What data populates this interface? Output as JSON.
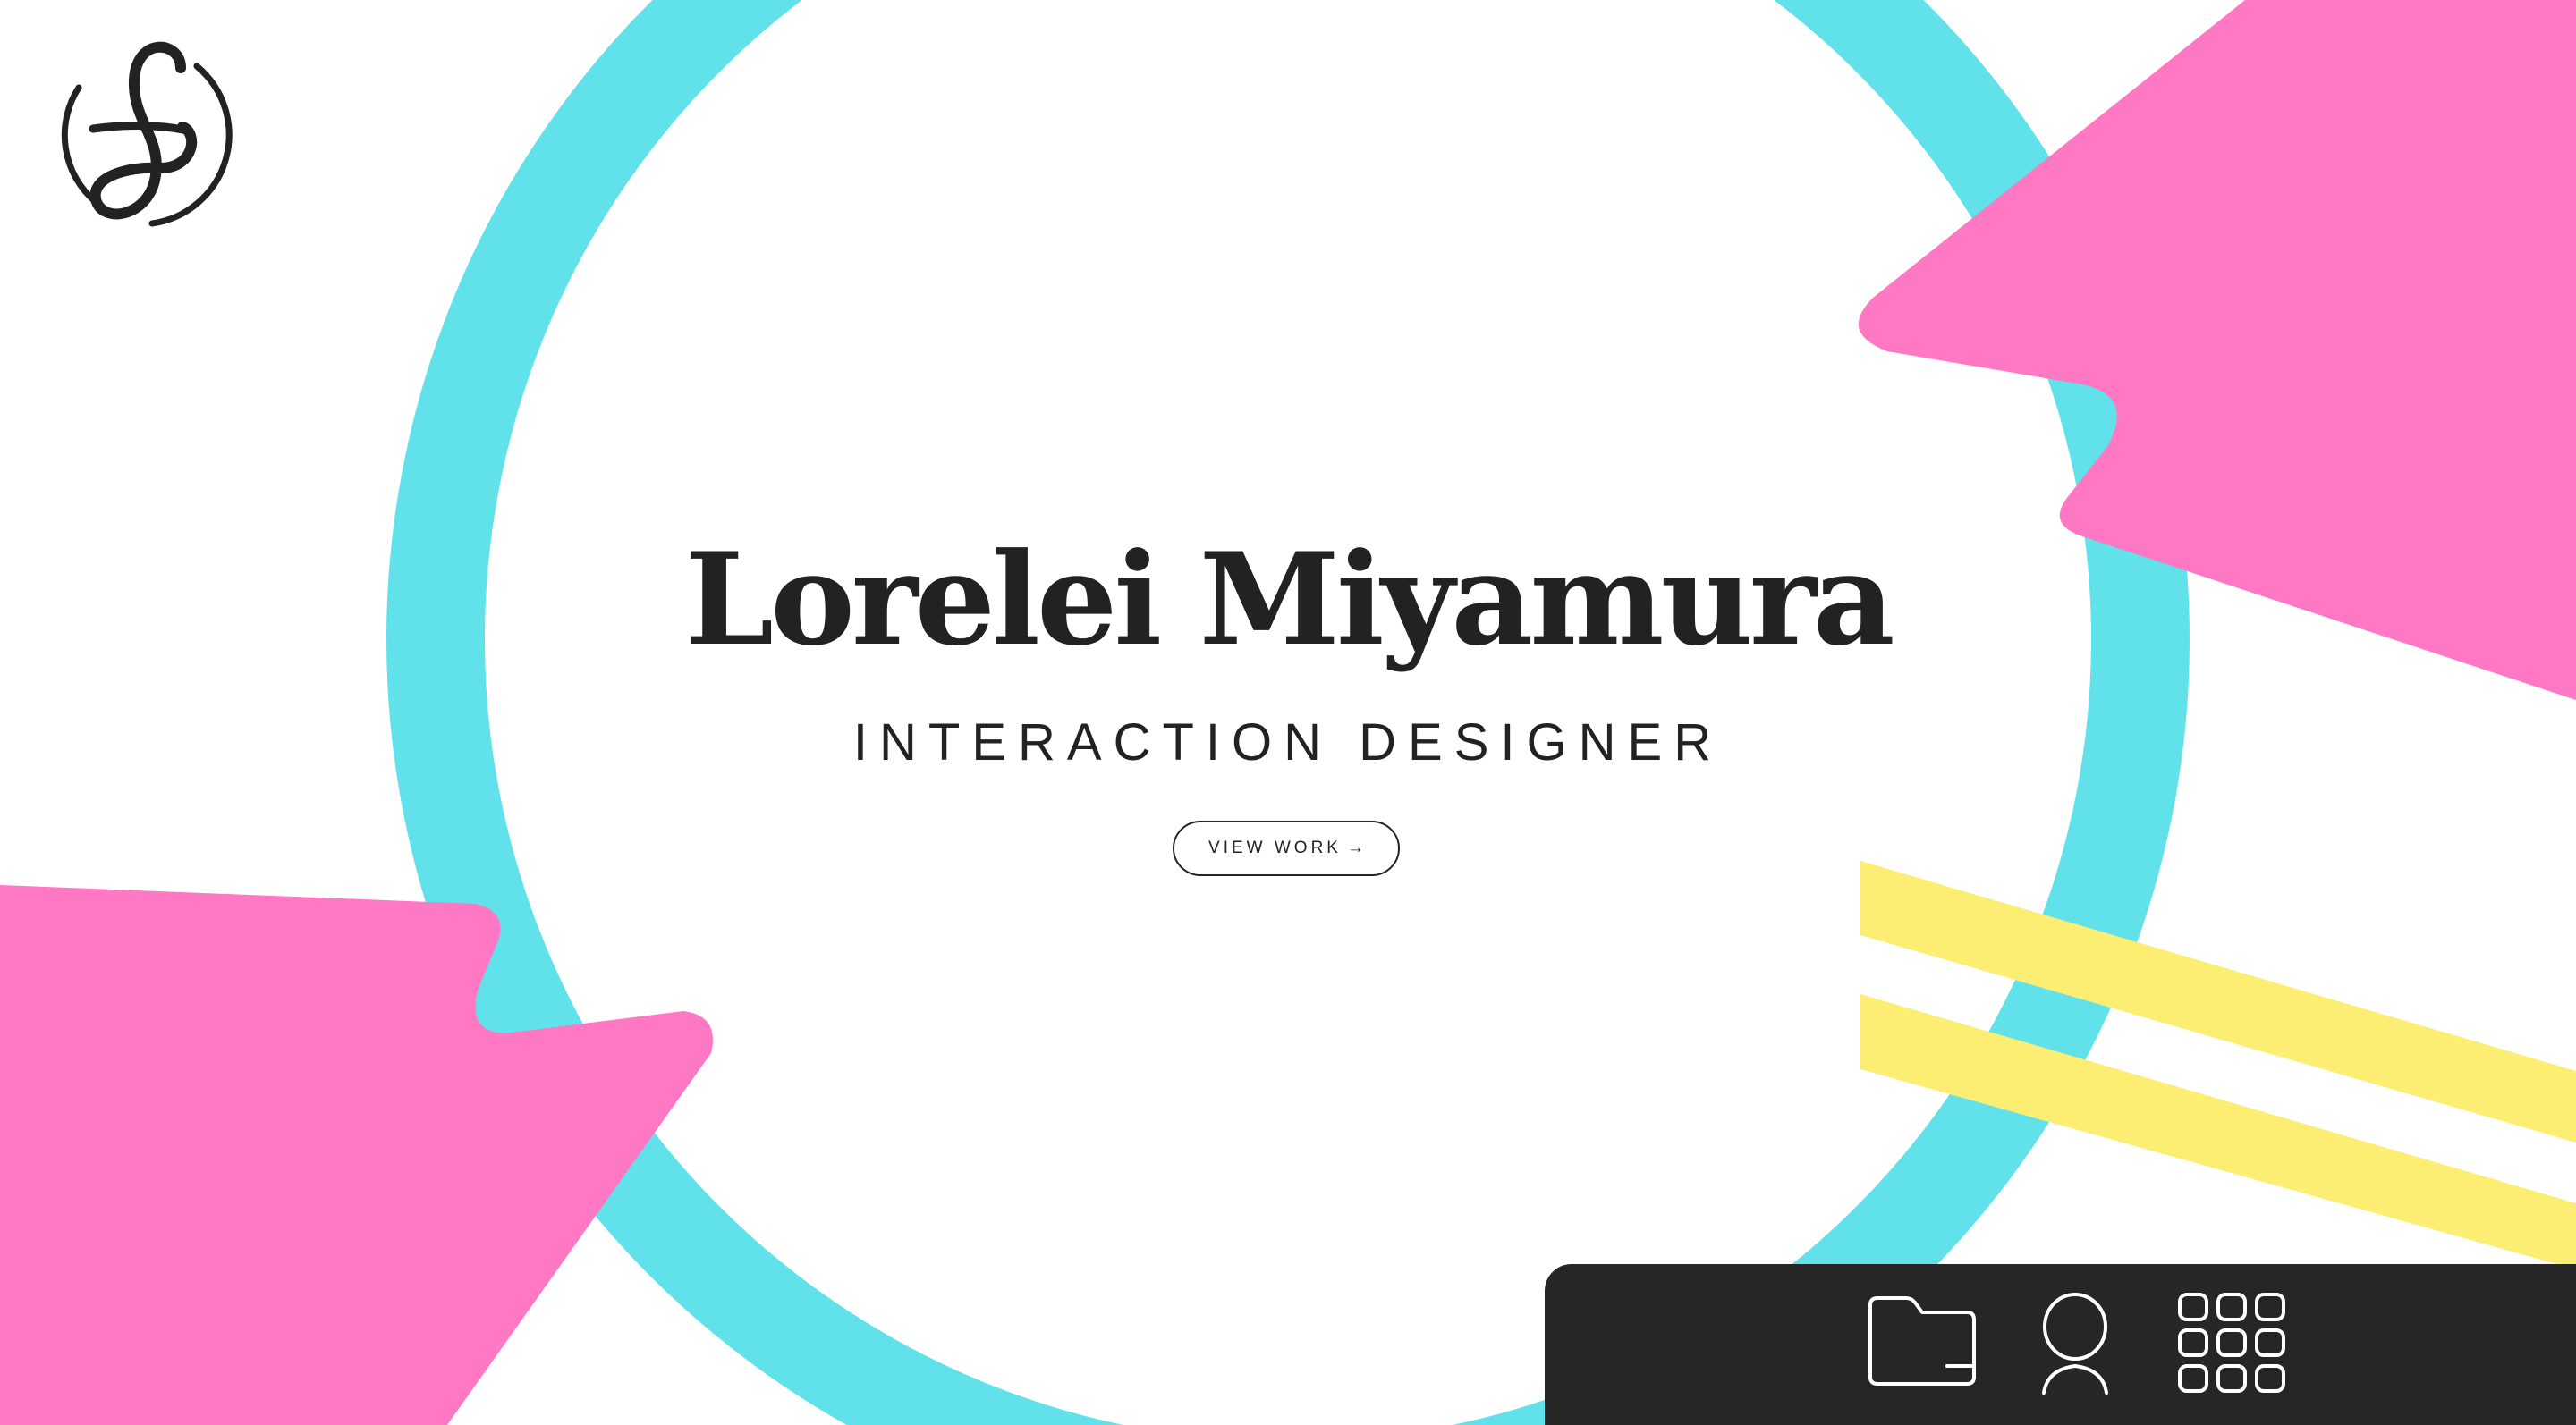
{
  "hero": {
    "name": "Lorelei Miyamura",
    "role": "INTERACTION DESIGNER",
    "cta_label": "VIEW WORK",
    "cta_arrow": "→"
  },
  "logo": {
    "monogram": "L"
  },
  "dock": {
    "icons": [
      "folder-icon",
      "person-icon",
      "app-grid-icon"
    ]
  },
  "colors": {
    "background": "#ffffff",
    "ring": "#61e2ea",
    "pink": "#ff78c4",
    "yellow": "#fbee73",
    "ink": "#222222",
    "dock": "#262626",
    "dock_icon": "#ffffff"
  }
}
